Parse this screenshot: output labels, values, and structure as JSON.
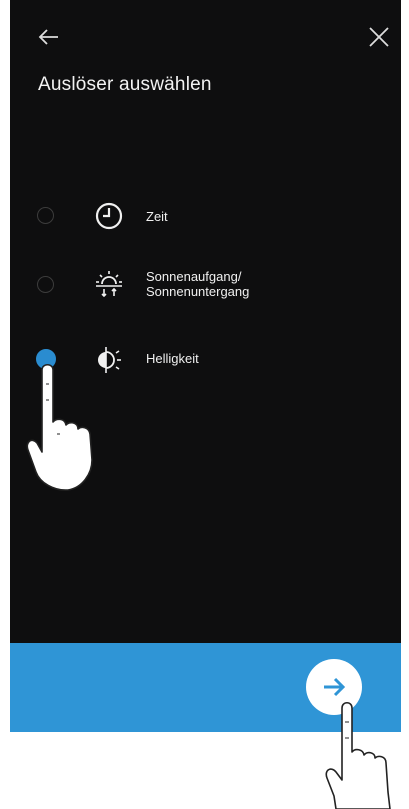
{
  "header": {
    "back_icon": "arrow-left-icon",
    "close_icon": "close-icon",
    "title": "Auslöser auswählen"
  },
  "options": [
    {
      "label": "Zeit",
      "icon": "clock-icon",
      "selected": false
    },
    {
      "label": "Sonnenaufgang/\nSonnenuntergang",
      "icon": "sunrise-sunset-icon",
      "selected": false
    },
    {
      "label": "Helligkeit",
      "icon": "brightness-icon",
      "selected": true
    }
  ],
  "footer": {
    "next_icon": "arrow-right-icon"
  },
  "colors": {
    "background": "#0e0e0f",
    "accent": "#2a8cd0",
    "footer_bar": "#2f95d6",
    "text": "#f0f0f0"
  }
}
